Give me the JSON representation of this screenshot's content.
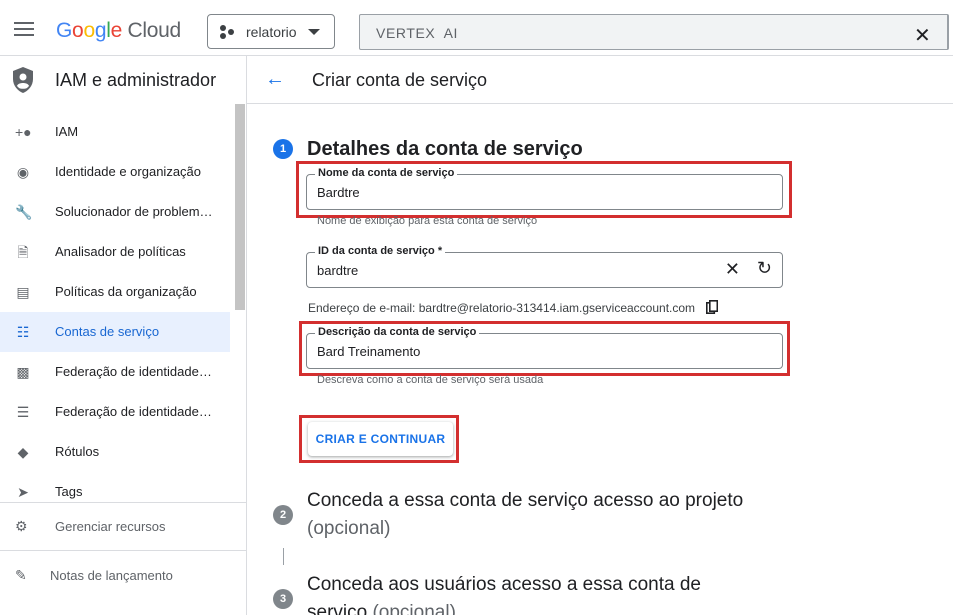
{
  "topbar": {
    "logo_text": "Google Cloud",
    "project": "relatorio",
    "search_value": "VERTEX  AI"
  },
  "sidebar": {
    "title": "IAM e administrador",
    "items": [
      {
        "label": "IAM",
        "icon": "person-add-icon"
      },
      {
        "label": "Identidade e organização",
        "icon": "account-circle-icon"
      },
      {
        "label": "Solucionador de problem…",
        "icon": "wrench-icon"
      },
      {
        "label": "Analisador de políticas",
        "icon": "document-search-icon"
      },
      {
        "label": "Políticas da organização",
        "icon": "list-doc-icon"
      },
      {
        "label": "Contas de serviço",
        "icon": "service-account-icon",
        "active": true
      },
      {
        "label": "Federação de identidade …",
        "icon": "id-card-icon"
      },
      {
        "label": "Federação de identidade …",
        "icon": "list-icon"
      },
      {
        "label": "Rótulos",
        "icon": "label-icon"
      },
      {
        "label": "Tags",
        "icon": "tag-icon"
      }
    ],
    "footer": [
      {
        "label": "Gerenciar recursos",
        "icon": "gear-box-icon"
      },
      {
        "label": "Notas de lançamento",
        "icon": "notes-icon"
      }
    ]
  },
  "main": {
    "page_title": "Criar conta de serviço",
    "step1": {
      "number": "1",
      "title": "Detalhes da conta de serviço",
      "name_field": {
        "label": "Nome da conta de serviço",
        "value": "Bardtre",
        "hint": "Nome de exibição para esta conta de serviço"
      },
      "id_field": {
        "label": "ID da conta de serviço *",
        "value": "bardtre"
      },
      "email_text": "Endereço de e-mail: bardtre@relatorio-313414.iam.gserviceaccount.com",
      "desc_field": {
        "label": "Descrição da conta de serviço",
        "value": "Bard Treinamento",
        "hint": "Descreva como a conta de serviço será usada"
      },
      "button": "CRIAR E CONTINUAR"
    },
    "step2": {
      "number": "2",
      "title": "Conceda a essa conta de serviço acesso ao projeto",
      "optional": "(opcional)"
    },
    "step3": {
      "number": "3",
      "title": "Conceda aos usuários acesso a essa conta de",
      "title_line2": "serviço",
      "optional": "(opcional)"
    }
  },
  "colors": {
    "accent": "#1a73e8",
    "highlight": "#d32f2f",
    "active_bg": "#e8f0fe"
  }
}
